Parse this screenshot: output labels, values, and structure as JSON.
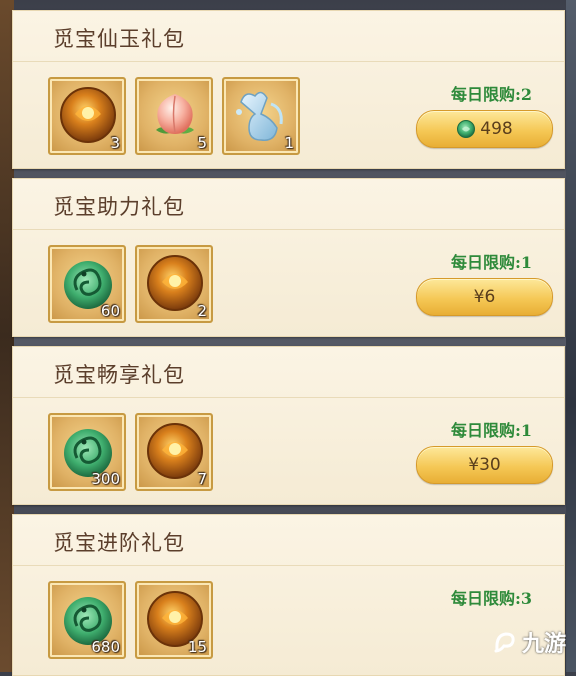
{
  "packs": [
    {
      "title": "觅宝仙玉礼包",
      "limit": "每日限购:2",
      "price": "498",
      "price_icon": "jade-coin-icon",
      "items": [
        {
          "icon": "amber-orb-icon",
          "qty": "3"
        },
        {
          "icon": "peach-icon",
          "qty": "5"
        },
        {
          "icon": "water-gourd-icon",
          "qty": "1"
        }
      ]
    },
    {
      "title": "觅宝助力礼包",
      "limit": "每日限购:1",
      "price": "¥6",
      "items": [
        {
          "icon": "jade-dragon-icon",
          "qty": "60"
        },
        {
          "icon": "amber-orb-icon",
          "qty": "2"
        }
      ]
    },
    {
      "title": "觅宝畅享礼包",
      "limit": "每日限购:1",
      "price": "¥30",
      "items": [
        {
          "icon": "jade-dragon-icon",
          "qty": "300"
        },
        {
          "icon": "amber-orb-icon",
          "qty": "7"
        }
      ]
    },
    {
      "title": "觅宝进阶礼包",
      "limit": "每日限购:3",
      "items": [
        {
          "icon": "jade-dragon-icon",
          "qty": "680"
        },
        {
          "icon": "amber-orb-icon",
          "qty": "15"
        }
      ]
    }
  ],
  "watermark": {
    "text": "九游",
    "icon": "jiuyou-logo-icon"
  },
  "colors": {
    "limit_text": "#2e8a3a",
    "card_bg": "#fbf4e4",
    "item_border": "#c79a42",
    "button_gold": "#f5c856"
  }
}
